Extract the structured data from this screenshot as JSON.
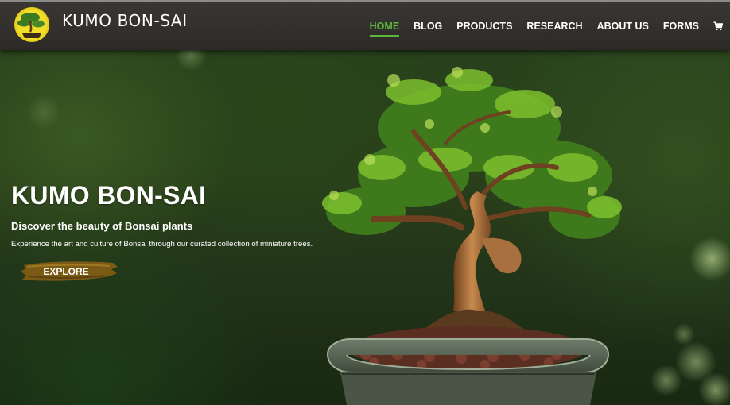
{
  "header": {
    "brand": "KUMO BON-SAI",
    "nav": [
      {
        "label": "HOME",
        "active": true
      },
      {
        "label": "BLOG",
        "active": false
      },
      {
        "label": "PRODUCTS",
        "active": false
      },
      {
        "label": "RESEARCH",
        "active": false
      },
      {
        "label": "ABOUT US",
        "active": false
      },
      {
        "label": "FORMS",
        "active": false
      }
    ],
    "cart_icon": "shopping-cart-icon",
    "logo_icon": "bonsai-logo-icon"
  },
  "hero": {
    "title": "KUMO BON-SAI",
    "subtitle": "Discover the beauty of Bonsai plants",
    "description": "Experience the art and culture of Bonsai through our curated collection of miniature trees.",
    "cta_label": "EXPLORE",
    "image": "bonsai-tree-in-pot"
  },
  "colors": {
    "header_bg": "#32302c",
    "active_nav": "#5cb83a",
    "cta_brush": "#7a5a14",
    "text": "#ffffff"
  }
}
